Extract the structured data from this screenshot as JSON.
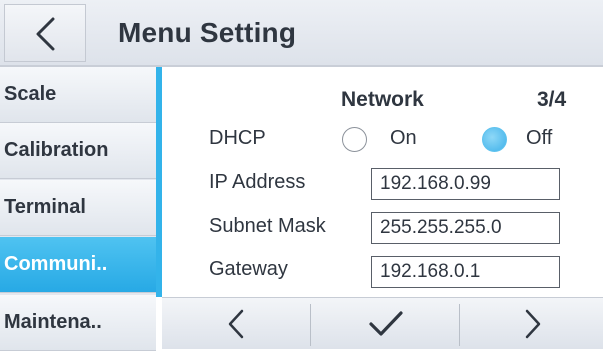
{
  "header": {
    "title": "Menu Setting"
  },
  "sidebar": {
    "items": [
      {
        "label": "Scale"
      },
      {
        "label": "Calibration"
      },
      {
        "label": "Terminal"
      },
      {
        "label": "Communi.."
      },
      {
        "label": "Maintena.."
      }
    ],
    "active_index": 3
  },
  "content": {
    "section_title": "Network",
    "page_indicator": "3/4",
    "dhcp": {
      "label": "DHCP",
      "options": [
        {
          "label": "On",
          "selected": false
        },
        {
          "label": "Off",
          "selected": true
        }
      ]
    },
    "fields": [
      {
        "label": "IP Address",
        "value": "192.168.0.99"
      },
      {
        "label": "Subnet Mask",
        "value": "255.255.255.0"
      },
      {
        "label": "Gateway",
        "value": "192.168.0.1"
      }
    ]
  },
  "icons": {
    "back": "chevron-left-icon",
    "prev": "chevron-left-icon",
    "confirm": "checkmark-icon",
    "next": "chevron-right-icon"
  },
  "colors": {
    "accent": "#33b3ea",
    "active_item": "#27a9e5",
    "text": "#2f3640"
  }
}
